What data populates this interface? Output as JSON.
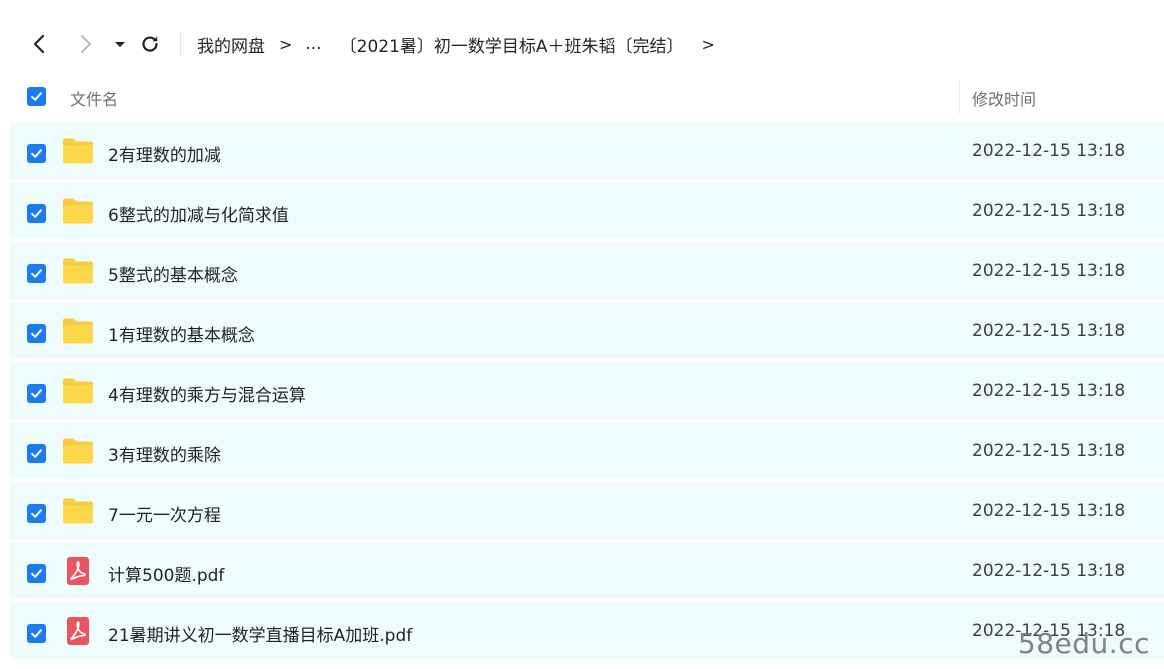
{
  "toolbar": {
    "back_icon": "chevron-left-icon",
    "forward_icon": "chevron-right-icon",
    "dropdown_icon": "caret-down-icon",
    "refresh_icon": "refresh-icon"
  },
  "breadcrumb": {
    "items": [
      "我的网盘",
      "...",
      "〔2021暑〕初一数学目标A＋班朱韬〔完结〕"
    ],
    "separator": ">"
  },
  "header": {
    "name_label": "文件名",
    "time_label": "修改时间"
  },
  "files": [
    {
      "name": "2有理数的加减",
      "modified": "2022-12-15 13:18",
      "type": "folder-icon"
    },
    {
      "name": "6整式的加减与化简求值",
      "modified": "2022-12-15 13:18",
      "type": "folder-icon"
    },
    {
      "name": "5整式的基本概念",
      "modified": "2022-12-15 13:18",
      "type": "folder-icon"
    },
    {
      "name": "1有理数的基本概念",
      "modified": "2022-12-15 13:18",
      "type": "folder-icon"
    },
    {
      "name": "4有理数的乘方与混合运算",
      "modified": "2022-12-15 13:18",
      "type": "folder-icon"
    },
    {
      "name": "3有理数的乘除",
      "modified": "2022-12-15 13:18",
      "type": "folder-icon"
    },
    {
      "name": "7一元一次方程",
      "modified": "2022-12-15 13:18",
      "type": "folder-icon"
    },
    {
      "name": "计算500题.pdf",
      "modified": "2022-12-15 13:18",
      "type": "pdf-icon"
    },
    {
      "name": "21暑期讲义初一数学直播目标A加班.pdf",
      "modified": "2022-12-15 13:18",
      "type": "pdf-icon"
    }
  ],
  "watermark": "58edu.cc",
  "colors": {
    "accent": "#1a7cf2",
    "row_bg": "#eefcfd",
    "folder": "#f8cc3c",
    "pdf": "#e9555e"
  }
}
